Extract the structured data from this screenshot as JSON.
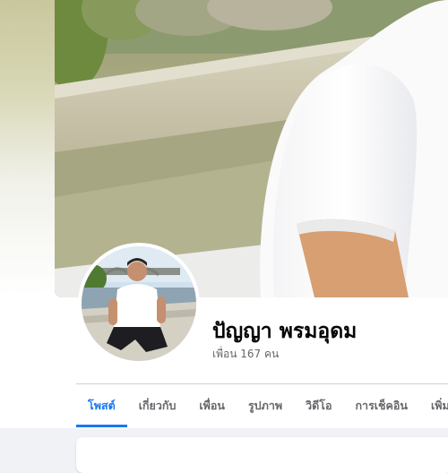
{
  "profile": {
    "name": "ปัญญา พรมอุดม",
    "friends_text": "เพื่อน 167 คน"
  },
  "tabs": [
    {
      "label": "โพสต์",
      "active": true
    },
    {
      "label": "เกี่ยวกับ",
      "active": false
    },
    {
      "label": "เพื่อน",
      "active": false
    },
    {
      "label": "รูปภาพ",
      "active": false
    },
    {
      "label": "วิดีโอ",
      "active": false
    },
    {
      "label": "การเช็คอิน",
      "active": false
    },
    {
      "label": "เพิ่ม",
      "active": false
    }
  ],
  "colors": {
    "accent": "#1877f2",
    "text_primary": "#050505",
    "text_secondary": "#65676b",
    "page_background": "#f0f2f5"
  }
}
